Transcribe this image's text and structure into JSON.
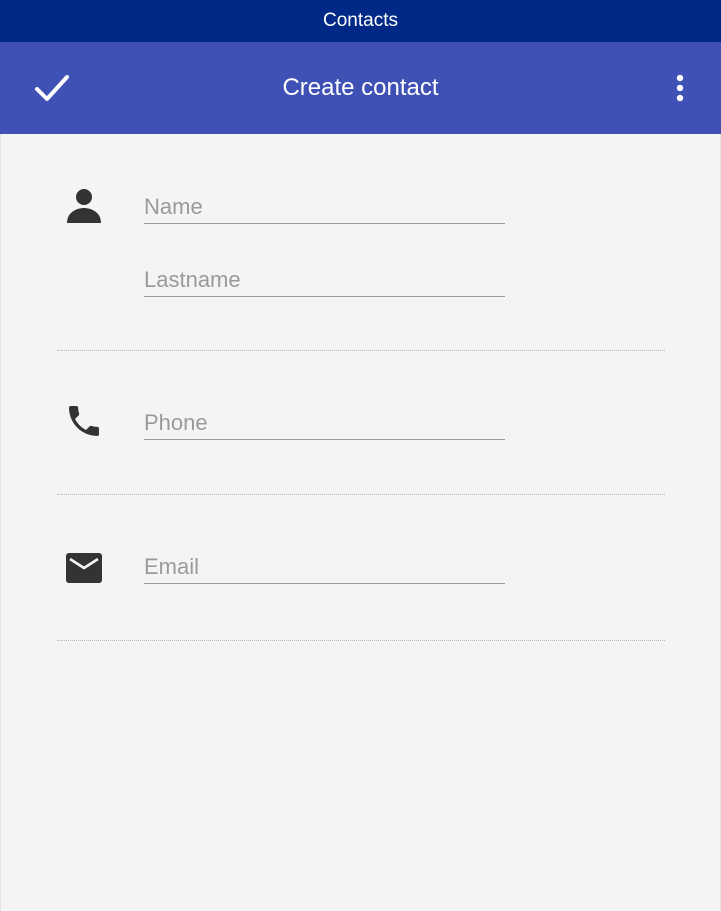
{
  "window": {
    "title": "Contacts"
  },
  "toolbar": {
    "title": "Create contact",
    "confirm_icon": "check-icon",
    "menu_icon": "more-vert-icon"
  },
  "form": {
    "name": {
      "icon": "person-icon",
      "placeholder": "Name",
      "value": ""
    },
    "lastname": {
      "placeholder": "Lastname",
      "value": ""
    },
    "phone": {
      "icon": "phone-icon",
      "placeholder": "Phone",
      "value": ""
    },
    "email": {
      "icon": "email-icon",
      "placeholder": "Email",
      "value": ""
    }
  },
  "colors": {
    "titlebar": "#002887",
    "toolbar": "#3f51b5",
    "background": "#f4f4f4",
    "icon": "#333333",
    "placeholder": "#9a9a9a"
  }
}
